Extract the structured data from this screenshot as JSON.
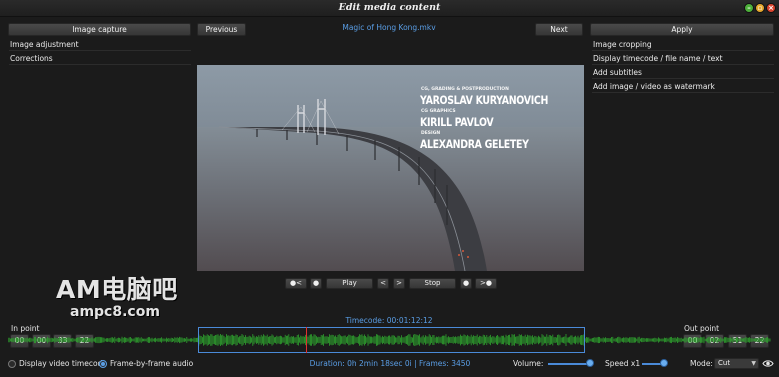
{
  "window": {
    "title": "Edit media content",
    "controls": [
      "minimize-icon",
      "maximize-icon",
      "close-icon"
    ]
  },
  "toolbar": {
    "capture_label": "Image capture",
    "previous_label": "Previous",
    "next_label": "Next",
    "apply_label": "Apply",
    "file_name": "Magic of Hong Kong.mkv"
  },
  "left_panel": {
    "items": [
      "Image adjustment",
      "Corrections"
    ]
  },
  "right_panel": {
    "items": [
      "Image cropping",
      "Display timecode / file name / text",
      "Add subtitles",
      "Add image / video as watermark"
    ]
  },
  "video_overlay": {
    "credit1_role": "CG, GRADING & POSTPRODUCTION",
    "credit1_name": "YAROSLAV KURYANOVICH",
    "credit2_role": "CG GRAPHICS",
    "credit2_name": "KIRILL PAVLOV",
    "credit3_role": "DESIGN",
    "credit3_name": "ALEXANDRA GELETEY"
  },
  "playback": {
    "rewind_label": "●<",
    "mark_left_label": "●",
    "play_label": "Play",
    "step_back_label": "<",
    "step_forward_label": ">",
    "stop_label": "Stop",
    "mark_right_label": "●",
    "forward_label": ">●"
  },
  "watermark": {
    "line1": "AM电脑吧",
    "line2": "ampc8.com"
  },
  "timeline": {
    "timecode": "Timecode: 00:01:12:12",
    "in_point_label": "In point",
    "in_point": [
      "00",
      "00",
      "33",
      "22"
    ],
    "out_point_label": "Out point",
    "out_point": [
      "00",
      "02",
      "51",
      "22"
    ],
    "playhead_fraction": 0.28,
    "waveform_color": "#2fa52f",
    "playhead_color": "#e03030"
  },
  "statusbar": {
    "display_timecode_label": "Display video timecode",
    "display_timecode_checked": false,
    "frame_audio_label": "Frame-by-frame audio",
    "frame_audio_checked": true,
    "duration": "Duration: 0h 2min 18sec 0i | Frames: 3450",
    "volume_label": "Volume:",
    "volume_fraction": 0.95,
    "speed_label": "Speed x1",
    "speed_fraction": 0.9,
    "mode_label": "Mode:",
    "mode_value": "Cut",
    "eye_icon": "eye-icon"
  },
  "colors": {
    "accent": "#5a9ee6",
    "background": "#1b1b1b",
    "button": "#3f3f3f"
  }
}
